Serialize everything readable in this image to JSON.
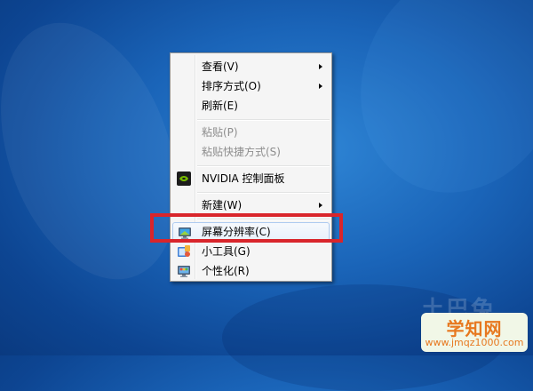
{
  "context_menu": {
    "items": [
      {
        "label": "查看(V)"
      },
      {
        "label": "排序方式(O)"
      },
      {
        "label": "刷新(E)"
      },
      {
        "label": "粘贴(P)"
      },
      {
        "label": "粘贴快捷方式(S)"
      },
      {
        "label": "NVIDIA 控制面板"
      },
      {
        "label": "新建(W)"
      },
      {
        "label": "屏幕分辨率(C)"
      },
      {
        "label": "小工具(G)"
      },
      {
        "label": "个性化(R)"
      }
    ],
    "disabled_items": [
      "粘贴(P)",
      "粘贴快捷方式(S)"
    ],
    "highlighted_item": "屏幕分辨率(C)",
    "icons": {
      "nvidia": "nvidia-logo-icon",
      "resolution": "monitor-icon",
      "gadgets": "gadgets-icon",
      "personalize": "personalize-monitor-icon"
    }
  },
  "annotation": {
    "highlight_color": "#d9252b"
  },
  "watermark": {
    "faint_text": "土巴兔",
    "site_name": "学知网",
    "site_url": "www.jmqz1000.com"
  },
  "colors": {
    "desktop_blue": "#1a64b8",
    "menu_bg": "#f5f5f5"
  }
}
